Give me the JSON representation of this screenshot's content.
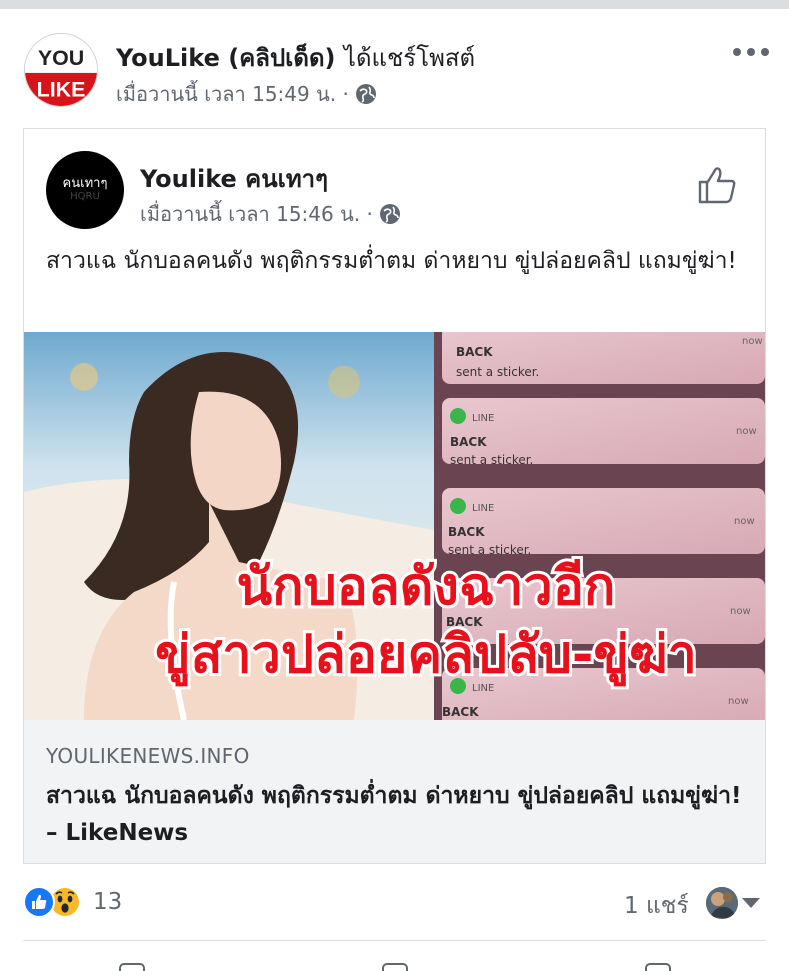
{
  "outer_post": {
    "page_name": "YouLike (คลิปเด็ด)",
    "action": "ได้แชร์โพสต์",
    "meta": "เมื่อวานนี้ เวลา 15:49 น. ·",
    "avatar_text_top": "YOU",
    "avatar_text_bottom": "LIKE"
  },
  "shared_post": {
    "page_name": "Youlike คนเทาๆ",
    "avatar_text_top": "คนเทาๆ",
    "avatar_text_bottom": "HQRU",
    "meta": "เมื่อวานนี้ เวลา 15:46 น. ·",
    "text": "สาวแฉ นักบอลคนดัง พฤติกรรมต่ำตม ด่าหยาบ ขู่ปล่อยคลิป แถมขู่ฆ่า!"
  },
  "image": {
    "headline_line1": "นักบอลดังฉาวอีก",
    "headline_line2": "ขู่สาวปล่อยคลิปลับ-ขู่ฆ่า",
    "notifications": [
      {
        "app": "",
        "sender": "BACK",
        "message": "sent a sticker.",
        "time": "now"
      },
      {
        "app": "LINE",
        "sender": "BACK",
        "message": "sent a sticker.",
        "time": "now"
      },
      {
        "app": "LINE",
        "sender": "BACK",
        "message": "sent a sticker.",
        "time": "now"
      },
      {
        "app": "",
        "sender": "BACK",
        "message": "",
        "time": "now"
      },
      {
        "app": "LINE",
        "sender": "BACK",
        "message": "",
        "time": "now"
      }
    ]
  },
  "link_preview": {
    "domain": "YOULIKENEWS.INFO",
    "title": "สาวแฉ นักบอลคนดัง พฤติกรรมต่ำตม ด่าหยาบ ขู่ปล่อยคลิป แถมขู่ฆ่า! – LikeNews"
  },
  "engagement": {
    "reaction_count": "13",
    "shares": "1 แชร์"
  },
  "icons": {
    "more": "more-horizontal-icon",
    "globe": "globe-icon",
    "like_page": "thumbs-up-outline-icon",
    "like_reaction": "like-reaction-icon",
    "wow_reaction": "wow-reaction-icon"
  },
  "colors": {
    "brand_blue": "#1877f2",
    "wow_yellow": "#f7b928",
    "headline_red": "#e8101a",
    "secondary_text": "#606770"
  }
}
